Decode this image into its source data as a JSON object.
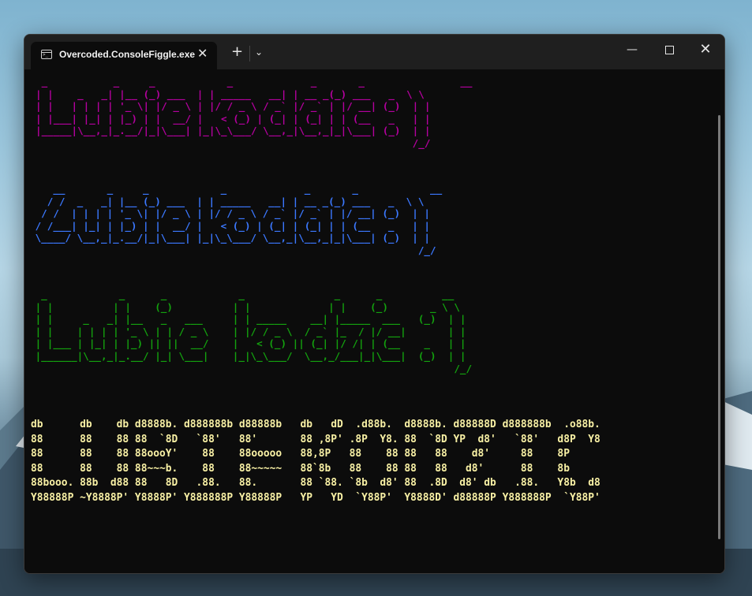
{
  "window": {
    "tab_title": "Overcoded.ConsoleFiggle.exe",
    "tab_close_glyph": "✕",
    "new_tab_glyph": "+",
    "dropdown_glyph": "⌄",
    "minimize_glyph": "—",
    "close_glyph": "✕"
  },
  "terminal": {
    "colors": {
      "magenta": "#b4009e",
      "blue": "#3b78ff",
      "green": "#13a10e",
      "yellow": "#f9f1a5"
    },
    "banner_magenta": " _           _     _            _             _       _                __\n| |    _   _| |__ (_) ___  | | _____   __| | __ _(_) ___   _  \\ \\\n| |   | | | | '_ \\| |/ _ \\ | |/ / _ \\ / _` |/ _` | |/ __| (_)  | |\n| |___| |_| | |_) | |  __/ |   < (_) | (_| | (_| | | (__   _   | |\n|_____|\\__,_|_.__/|_|\\___| |_|\\_\\___/ \\__,_|\\__,_|_|\\___| (_)  | |\n                                                               /_/",
    "banner_blue": "    __       _     _            _             _       _            __\n   / /  _   _| |__ (_) ___  | | _____   __| | __ _(_) ___   _  \\ \\\n  / /  | | | | '_ \\| |/ _ \\ | |/ / _ \\ / _` |/ _` | |/ __| (_)  | |\n / /___| |_| | |_) | |  __/ |   < (_) | (_| | (_| | | (__   _   | |\n \\____/ \\__,_|_.__/|_|\\___| |_|\\_\\___/ \\__,_|\\__,_|_|\\___| (_)  | |\n                                                                 /_/",
    "banner_green": "  _            _      _            _               _      _          __\n | |          | |    (_)          | |             | |    (_)       _ \\ \\\n | |     _   _| |__   _   ___     | | _____    __| |_____  ___   (_)  | |\n | |    | | | | '_ \\ | | / _ \\    | |/ / _ \\  / _` |_  / |/ __|       | |\n | |___ | |_| | |_) || ||  __/    |   < (_) || (_| |/ /| | (__    _   | |\n |______|\\__,_|_.__/ |_| \\___|    |_|\\_\\___/  \\__,_/___|_|\\___|  (_)  | |\n                                                                       /_/",
    "banner_yellow": "db      db    db d8888b. d888888b d88888b   db   dD  .d88b.  d8888b. d88888D d888888b  .o88b.\n88      88    88 88  `8D   `88'   88'       88 ,8P' .8P  Y8. 88  `8D YP  d8'   `88'   d8P  Y8\n88      88    88 88oooY'    88    88ooooo   88,8P   88    88 88   88    d8'     88    8P\n88      88    88 88~~~b.    88    88~~~~~   88`8b   88    88 88   88   d8'      88    8b\n88booo. 88b  d88 88   8D   .88.   88.       88 `88. `8b  d8' 88  .8D  d8' db   .88.   Y8b  d8\nY88888P ~Y8888P' Y8888P' Y888888P Y88888P   YP   YD  `Y88P'  Y8888D' d88888P Y888888P  `Y88P'"
  }
}
